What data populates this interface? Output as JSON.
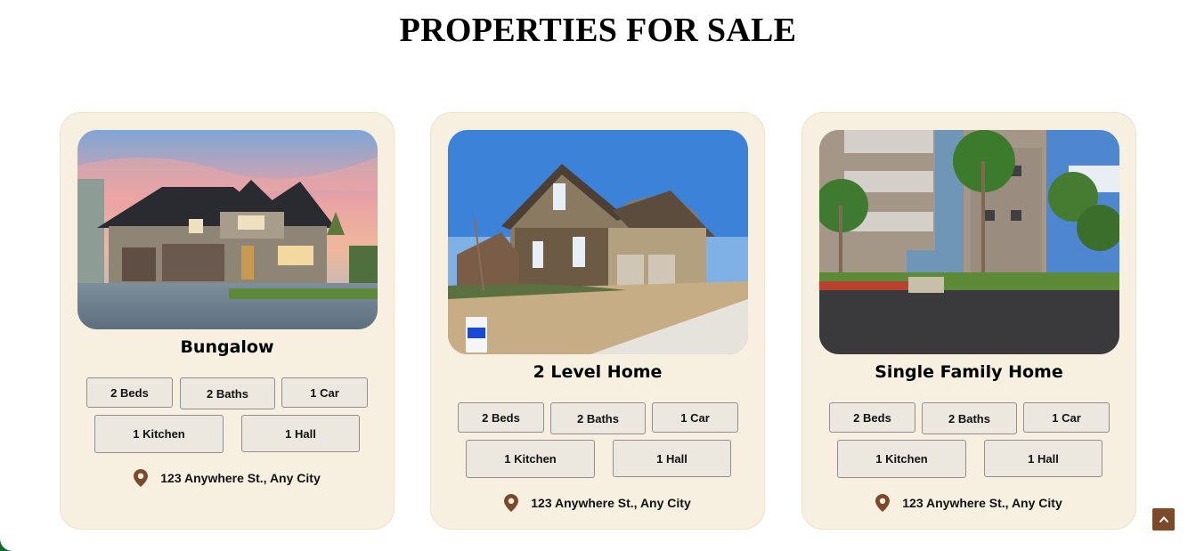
{
  "page": {
    "title": "PROPERTIES FOR SALE"
  },
  "colors": {
    "card_bg": "#f7f0e1",
    "chip_bg": "#ece7df",
    "accent_brown": "#7a4a2a"
  },
  "listings": [
    {
      "name": "Bungalow",
      "image": "craftsman-house-sunset-photo",
      "features": {
        "beds": "2 Beds",
        "baths": "2 Baths",
        "car": "1 Car",
        "kitchen": "1 Kitchen",
        "hall": "1 Hall"
      },
      "address": "123 Anywhere St., Any City"
    },
    {
      "name": "2 Level Home",
      "image": "two-story-house-photo",
      "features": {
        "beds": "2 Beds",
        "baths": "2 Baths",
        "car": "1 Car",
        "kitchen": "1 Kitchen",
        "hall": "1 Hall"
      },
      "address": "123 Anywhere St., Any City"
    },
    {
      "name": "Single Family Home",
      "image": "apartment-building-palms-photo",
      "features": {
        "beds": "2 Beds",
        "baths": "2 Baths",
        "car": "1 Car",
        "kitchen": "1 Kitchen",
        "hall": "1 Hall"
      },
      "address": "123 Anywhere St., Any City"
    }
  ],
  "icons": {
    "location": "location-pin-icon",
    "scroll_top": "chevron-up-icon"
  }
}
